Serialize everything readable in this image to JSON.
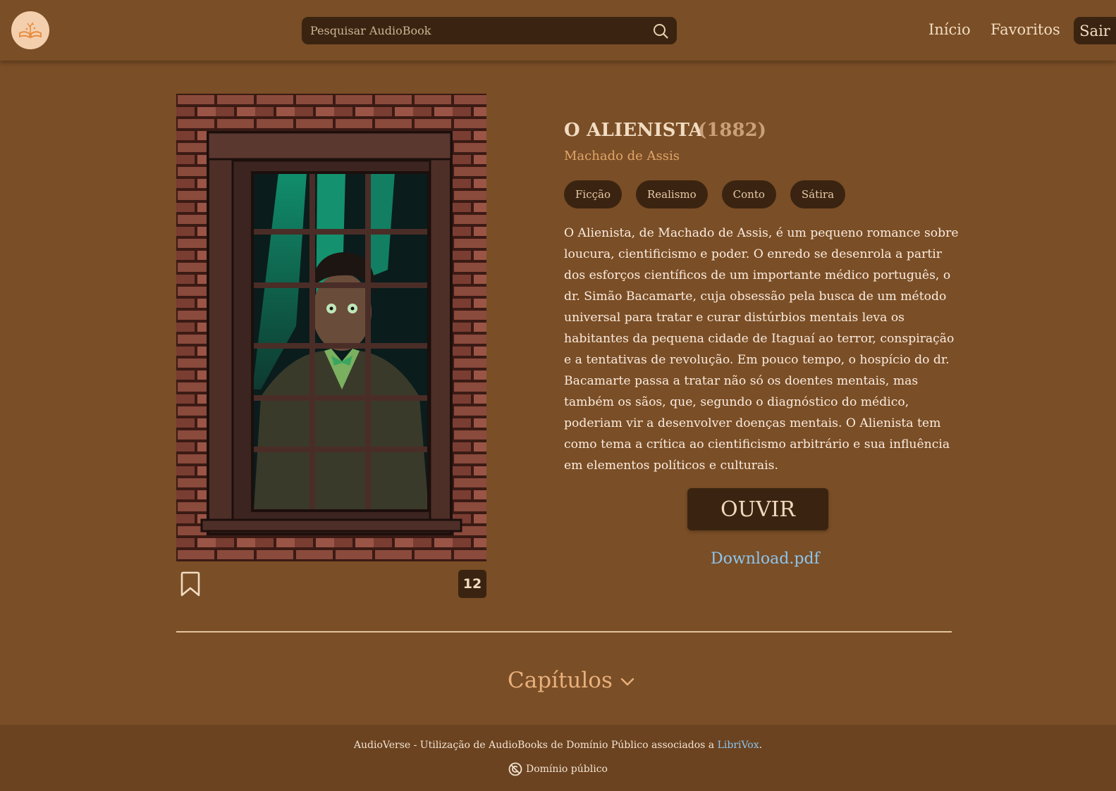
{
  "header": {
    "search": {
      "placeholder": "Pesquisar AudioBook",
      "value": ""
    },
    "nav": {
      "home": "Início",
      "favorites": "Favoritos",
      "logout": "Sair"
    }
  },
  "book": {
    "title": "O ALIENISTA",
    "year": "(1882)",
    "author": "Machado de Assis",
    "tags": [
      "Ficção",
      "Realismo",
      "Conto",
      "Sátira"
    ],
    "description": "O Alienista, de Machado de Assis, é um pequeno romance sobre loucura, cientificismo e poder. O enredo se desenrola a partir dos esforços científicos de um importante médico português, o dr. Simão Bacamarte, cuja obsessão pela busca de um método universal para tratar e curar distúrbios mentais leva os habitantes da pequena cidade de Itaguaí ao terror, conspiração e a tentativas de revolução. Em pouco tempo, o hospício do dr. Bacamarte passa a tratar não só os doentes mentais, mas também os sãos, que, segundo o diagnóstico do médico, poderiam vir a desenvolver doenças mentais. O Alienista tem como tema a crítica ao cientificismo arbitrário e sua influência em elementos políticos e culturais.",
    "count": "12",
    "listen_label": "OUVIR",
    "download_label": "Download.pdf"
  },
  "chapters": {
    "label": "Capítulos"
  },
  "footer": {
    "text_before": "AudioVerse - Utilização de AudioBooks de Domínio Público associados a ",
    "link": "LibriVox",
    "text_after": ".",
    "license": "Domínio público"
  },
  "icons": {
    "logo": "open-book-logo-icon",
    "search": "search-icon",
    "bookmark": "bookmark-icon",
    "chevron": "chevron-down-icon",
    "license": "public-domain-icon"
  },
  "colors": {
    "background": "#7a4e26",
    "dark_accent": "#3a2411",
    "title_text": "#f1dcc2",
    "author_text": "#e1a46a",
    "link": "#8cc6f0"
  }
}
